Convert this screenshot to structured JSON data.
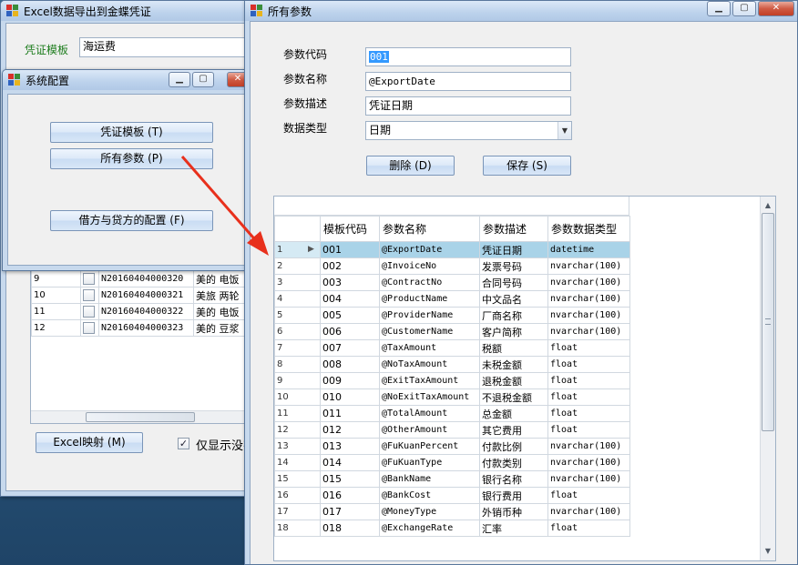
{
  "main_window": {
    "title": "Excel数据导出到金蝶凭证",
    "voucher_template_label": "凭证模板",
    "voucher_template_value": "海运费",
    "rows": [
      {
        "index": "9",
        "code": "N20160404000320",
        "text": "美的 电饭"
      },
      {
        "index": "10",
        "code": "N20160404000321",
        "text": "美旅 两轮"
      },
      {
        "index": "11",
        "code": "N20160404000322",
        "text": "美的 电饭"
      },
      {
        "index": "12",
        "code": "N20160404000323",
        "text": "美的 豆浆"
      }
    ],
    "excel_mapping_button": "Excel映射 (M)",
    "show_only_label": "仅显示没有"
  },
  "config_window": {
    "title": "系统配置",
    "voucher_template_button": "凭证模板 (T)",
    "all_params_button": "所有参数 (P)",
    "debit_credit_button": "借方与贷方的配置 (F)"
  },
  "params_window": {
    "title": "所有参数",
    "code_label": "参数代码",
    "code_value": "001",
    "name_label": "参数名称",
    "name_value": "@ExportDate",
    "desc_label": "参数描述",
    "desc_value": "凭证日期",
    "type_label": "数据类型",
    "type_value": "日期",
    "delete_button": "删除 (D)",
    "save_button": "保存 (S)",
    "columns": [
      "模板代码",
      "参数名称",
      "参数描述",
      "参数数据类型"
    ],
    "rows": [
      {
        "n": "1",
        "code": "001",
        "name": "@ExportDate",
        "desc": "凭证日期",
        "type": "datetime"
      },
      {
        "n": "2",
        "code": "002",
        "name": "@InvoiceNo",
        "desc": "发票号码",
        "type": "nvarchar(100)"
      },
      {
        "n": "3",
        "code": "003",
        "name": "@ContractNo",
        "desc": "合同号码",
        "type": "nvarchar(100)"
      },
      {
        "n": "4",
        "code": "004",
        "name": "@ProductName",
        "desc": "中文品名",
        "type": "nvarchar(100)"
      },
      {
        "n": "5",
        "code": "005",
        "name": "@ProviderName",
        "desc": "厂商名称",
        "type": "nvarchar(100)"
      },
      {
        "n": "6",
        "code": "006",
        "name": "@CustomerName",
        "desc": "客户简称",
        "type": "nvarchar(100)"
      },
      {
        "n": "7",
        "code": "007",
        "name": "@TaxAmount",
        "desc": "税额",
        "type": "float"
      },
      {
        "n": "8",
        "code": "008",
        "name": "@NoTaxAmount",
        "desc": "未税金额",
        "type": "float"
      },
      {
        "n": "9",
        "code": "009",
        "name": "@ExitTaxAmount",
        "desc": "退税金额",
        "type": "float"
      },
      {
        "n": "10",
        "code": "010",
        "name": "@NoExitTaxAmount",
        "desc": "不退税金额",
        "type": "float"
      },
      {
        "n": "11",
        "code": "011",
        "name": "@TotalAmount",
        "desc": "总金额",
        "type": "float"
      },
      {
        "n": "12",
        "code": "012",
        "name": "@OtherAmount",
        "desc": "其它费用",
        "type": "float"
      },
      {
        "n": "13",
        "code": "013",
        "name": "@FuKuanPercent",
        "desc": "付款比例",
        "type": "nvarchar(100)"
      },
      {
        "n": "14",
        "code": "014",
        "name": "@FuKuanType",
        "desc": "付款类别",
        "type": "nvarchar(100)"
      },
      {
        "n": "15",
        "code": "015",
        "name": "@BankName",
        "desc": "银行名称",
        "type": "nvarchar(100)"
      },
      {
        "n": "16",
        "code": "016",
        "name": "@BankCost",
        "desc": "银行费用",
        "type": "float"
      },
      {
        "n": "17",
        "code": "017",
        "name": "@MoneyType",
        "desc": "外销币种",
        "type": "nvarchar(100)"
      },
      {
        "n": "18",
        "code": "018",
        "name": "@ExchangeRate",
        "desc": "汇率",
        "type": "float"
      }
    ]
  },
  "colors": {
    "accent_arrow": "#e8301c",
    "selected_row": "#a9d3e8",
    "label_green": "#1e7d1e"
  }
}
